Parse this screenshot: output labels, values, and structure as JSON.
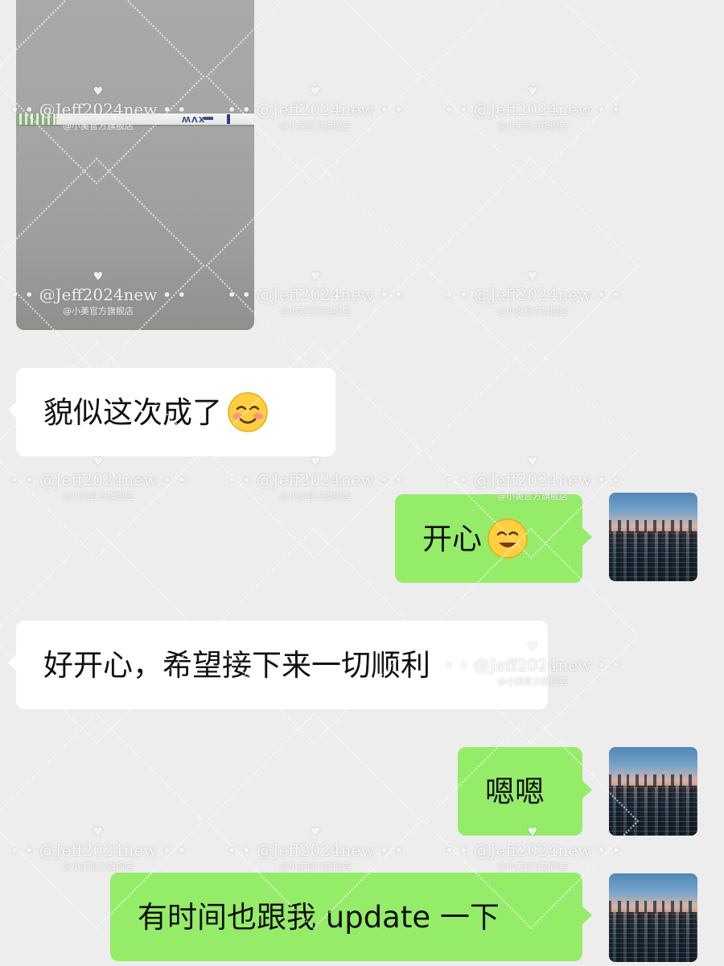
{
  "messages": [
    {
      "side": "incoming",
      "type": "image",
      "image_text": "XVW"
    },
    {
      "side": "incoming",
      "type": "text",
      "text": "貌似这次成了",
      "emoji": "smiling-blush-emoji"
    },
    {
      "side": "outgoing",
      "type": "text",
      "text": "开心",
      "emoji": "smiling-emoji"
    },
    {
      "side": "incoming",
      "type": "text",
      "text": "好开心，希望接下来一切顺利"
    },
    {
      "side": "outgoing",
      "type": "text",
      "text": "嗯嗯"
    },
    {
      "side": "outgoing",
      "type": "text",
      "text": "有时间也跟我 update 一下"
    }
  ],
  "avatar": {
    "icon": "city-skyline-avatar"
  },
  "watermark": {
    "main": "• • @Jeff2024new • •",
    "sub": "@小美官方旗舰店",
    "heart": "♥"
  },
  "colors": {
    "background": "#ededed",
    "incoming_bubble": "#ffffff",
    "outgoing_bubble": "#95ec69"
  }
}
